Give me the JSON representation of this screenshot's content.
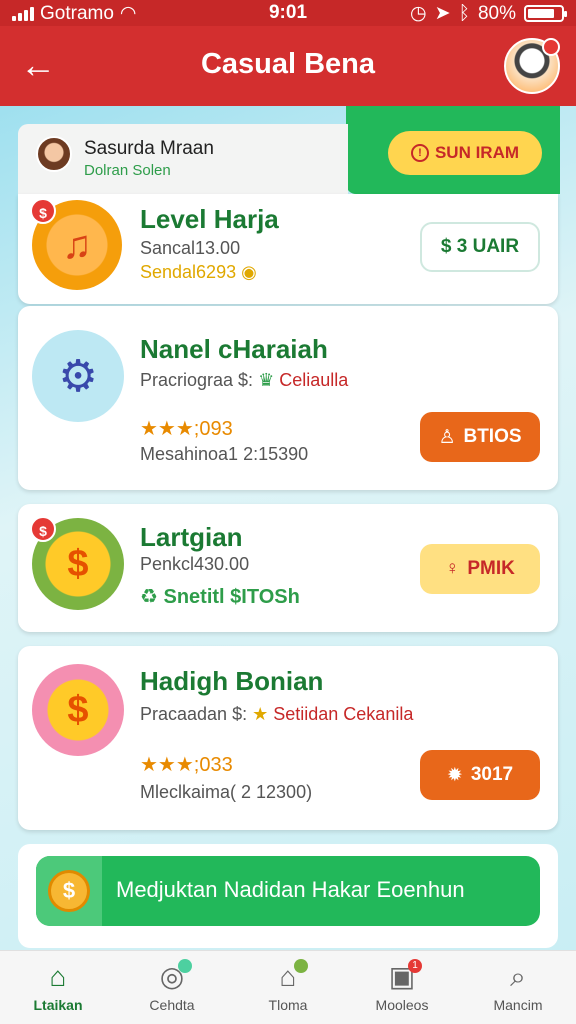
{
  "status_bar": {
    "carrier": "Gotramo",
    "time": "9:01",
    "battery": "80%",
    "battery_level": 0.8
  },
  "header": {
    "title": "Casual Bena"
  },
  "profile": {
    "name": "Sasurda Mraan",
    "subtitle": "Dolran Solen",
    "action_label": "SUN IRAM"
  },
  "cards": [
    {
      "title": "Level Harja",
      "line1": "Sancal13.00",
      "line2": "Sendal6293",
      "button": "$ 3 UAIR",
      "badge": "$"
    },
    {
      "title": "Nanel cHaraiah",
      "line1_prefix": "Pracriograa $:",
      "line1_highlight": "Celiaulla",
      "stars": "★★★;093",
      "line3": "Mesahinoa1 2:15390",
      "button": "BTIOS"
    },
    {
      "title": "Lartgian",
      "line1": "Penkcl430.00",
      "line2": "Snetitl $ITOSh",
      "button": "PMIK",
      "badge": "$"
    },
    {
      "title": "Hadigh Bonian",
      "line1_prefix": "Pracaadan $:",
      "line1_highlight": "Setiidan Cekanila",
      "stars": "★★★;033",
      "line3": "Mleclkaima( 2 12300)",
      "button": "3017"
    }
  ],
  "banner": {
    "text": "Medjuktan Nadidan Hakar Eoenhun"
  },
  "nav": [
    {
      "label": "Ltaikan",
      "icon": "home-icon",
      "active": true
    },
    {
      "label": "Cehdta",
      "icon": "target-icon",
      "active": false
    },
    {
      "label": "Tloma",
      "icon": "house-icon",
      "active": false
    },
    {
      "label": "Mooleos",
      "icon": "message-icon",
      "active": false,
      "badge": "1"
    },
    {
      "label": "Mancim",
      "icon": "search-icon",
      "active": false
    }
  ],
  "colors": {
    "header": "#d32f2f",
    "accent_green": "#22b85a",
    "title_green": "#1b7a33",
    "orange": "#e8671a",
    "gold": "#e0a800"
  }
}
